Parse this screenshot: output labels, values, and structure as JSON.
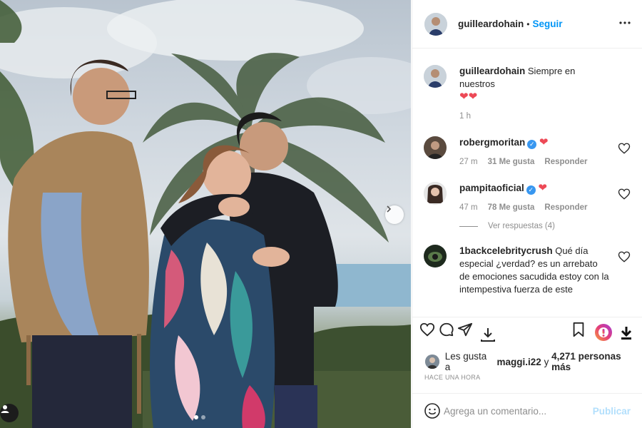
{
  "post": {
    "author": "guilleardohain",
    "follow_label": "Seguir",
    "separator": "•",
    "photo": {
      "description_icon": "photo-carousel",
      "slide_count": 2,
      "active_slide": 1
    }
  },
  "caption": {
    "username": "guilleardohain",
    "text": "Siempre en nuestros",
    "hearts": "❤❤",
    "time": "1 h"
  },
  "comments": [
    {
      "username": "robergmoritan",
      "verified": true,
      "text": "❤",
      "time": "27 m",
      "likes": "31 Me gusta",
      "reply_label": "Responder"
    },
    {
      "username": "pampitaoficial",
      "verified": true,
      "text": "❤",
      "time": "47 m",
      "likes": "78 Me gusta",
      "reply_label": "Responder",
      "view_replies": "Ver respuestas (4)"
    },
    {
      "username": "1backcelebritycrush",
      "verified": false,
      "text": "Qué día especial ¿verdad? es un arrebato de emociones sacudida estoy con la intempestiva fuerza de este"
    }
  ],
  "likes": {
    "prefix": "Les gusta a",
    "user": "maggi.i22",
    "connector": "y",
    "count": "4,271 personas más"
  },
  "timeago": "HACE UNA HORA",
  "add_comment": {
    "placeholder": "Agrega un comentario...",
    "publish_label": "Publicar"
  },
  "colors": {
    "accent": "#0095f6",
    "heart": "#ed4956",
    "verified": "#3897f0"
  }
}
